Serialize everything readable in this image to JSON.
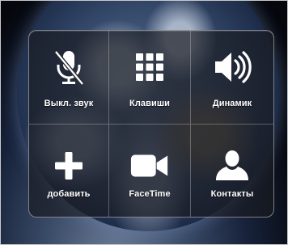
{
  "call_controls": [
    {
      "label": "Выкл. звук",
      "icon": "mute-microphone-icon"
    },
    {
      "label": "Клавиши",
      "icon": "keypad-icon"
    },
    {
      "label": "Динамик",
      "icon": "speaker-icon"
    },
    {
      "label": "добавить",
      "icon": "add-call-icon"
    },
    {
      "label": "FaceTime",
      "icon": "facetime-camera-icon"
    },
    {
      "label": "Контакты",
      "icon": "contacts-person-icon"
    }
  ],
  "colors": {
    "panel": "#1f2128",
    "icon": "#ffffff",
    "text": "#ffffff"
  }
}
